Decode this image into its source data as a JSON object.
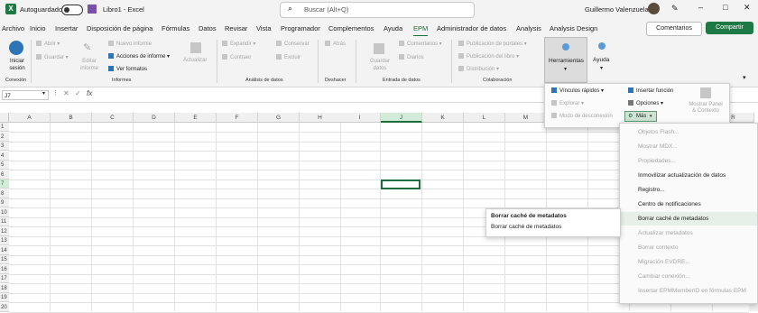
{
  "titlebar": {
    "autosave_label": "Autoguardado",
    "filename": "Libro1 - Excel",
    "search_placeholder": "Buscar (Alt+Q)",
    "user": "Guillermo Valenzuela"
  },
  "tabs": [
    "Archivo",
    "Inicio",
    "Insertar",
    "Disposición de página",
    "Fórmulas",
    "Datos",
    "Revisar",
    "Vista",
    "Programador",
    "Complementos",
    "Ayuda",
    "EPM",
    "Administrador de datos",
    "Analysis",
    "Analysis Design"
  ],
  "active_tab": "EPM",
  "actions": {
    "comentarios": "Comentarios",
    "compartir": "Compartir"
  },
  "ribbon": {
    "conexion": {
      "iniciar": "Iniciar sesión",
      "group": "Conexión"
    },
    "informes": {
      "abrir": "Abrir",
      "guardar": "Guardar",
      "editar": "Editar informe",
      "nuevo": "Nuevo informe",
      "acciones": "Acciones de informe",
      "ver_formatos": "Ver formatos",
      "actualizar": "Actualizar",
      "group": "Informes"
    },
    "analisis": {
      "expandir": "Expandir",
      "contraer": "Contraer",
      "conservar": "Conservar",
      "excluir": "Excluir",
      "group": "Análisis de datos"
    },
    "deshacer": {
      "atras": "Atrás",
      "group": "Deshacer"
    },
    "entrada": {
      "guardar_datos": "Guardar datos",
      "comentarios": "Comentarios",
      "diarios": "Diarios",
      "group": "Entrada de datos"
    },
    "colaboracion": {
      "pub_portales": "Publicación de portales",
      "pub_libro": "Publicación del libro",
      "distribucion": "Distribución",
      "group": "Colaboración"
    },
    "herramientas": "Herramientas",
    "ayuda": "Ayuda"
  },
  "formula_bar": {
    "cell": "J7",
    "fx": "fx"
  },
  "columns": [
    "A",
    "B",
    "C",
    "D",
    "E",
    "F",
    "G",
    "H",
    "I",
    "J",
    "K",
    "L",
    "M",
    "N",
    "O",
    "P",
    "Q",
    "R"
  ],
  "rows": [
    "1",
    "2",
    "3",
    "4",
    "5",
    "6",
    "7",
    "8",
    "9",
    "10",
    "11",
    "12",
    "13",
    "14",
    "15",
    "16",
    "17",
    "18",
    "19",
    "20"
  ],
  "selected_cell": {
    "col": "J",
    "row": "7"
  },
  "herramientas_panel": {
    "vinculos": "Vínculos rápidos",
    "explorar": "Explorar",
    "modo_desconexion": "Modo de desconexión",
    "insertar_funcion": "Insertar función",
    "opciones": "Opciones",
    "mas": "Más",
    "mostrar_panel": "Mostrar Panel & Contexto"
  },
  "mas_menu": [
    {
      "label": "Objetos Flash...",
      "enabled": false
    },
    {
      "label": "Mostrar MDX...",
      "enabled": false
    },
    {
      "label": "Propiedades...",
      "enabled": false
    },
    {
      "label": "Inmovilizar actualización de datos",
      "enabled": true
    },
    {
      "label": "Registro...",
      "enabled": true
    },
    {
      "label": "Centro de notificaciones",
      "enabled": true
    },
    {
      "label": "Borrar caché de metadatos",
      "enabled": true
    },
    {
      "label": "Actualizar metadatos",
      "enabled": false
    },
    {
      "label": "Borrar contexto",
      "enabled": false
    },
    {
      "label": "Migración EVDRE...",
      "enabled": false
    },
    {
      "label": "Cambiar conexión...",
      "enabled": false
    },
    {
      "label": "Insertar EPMMemberID en fórmulas EPM",
      "enabled": false
    }
  ],
  "tooltip": {
    "title": "Borrar caché de metadatos",
    "body": "Borrar caché de metadatos"
  },
  "colors": {
    "accent": "#1e6b3c",
    "compartir": "#1e7a45",
    "disabled": "#a6a6a6"
  }
}
